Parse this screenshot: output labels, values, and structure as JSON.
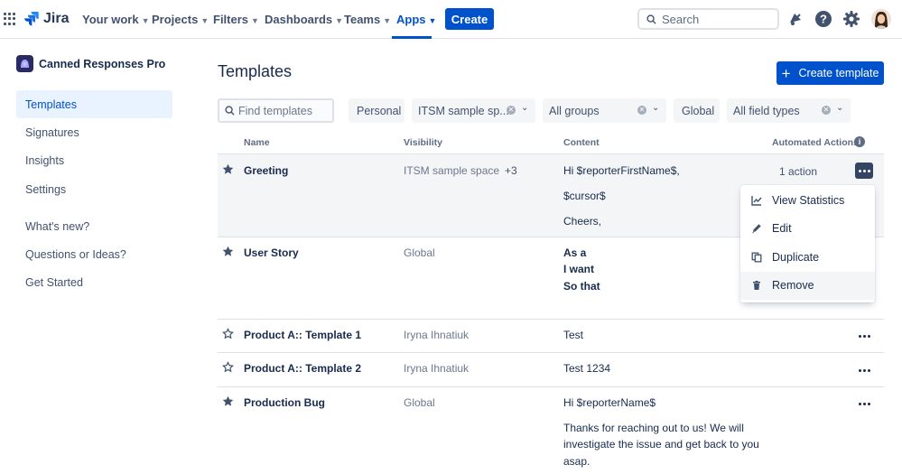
{
  "nav": {
    "logo_text": "Jira",
    "items": [
      {
        "label": "Your work"
      },
      {
        "label": "Projects"
      },
      {
        "label": "Filters"
      },
      {
        "label": "Dashboards"
      },
      {
        "label": "Teams"
      },
      {
        "label": "Apps"
      }
    ],
    "active_item": "Apps",
    "create_label": "Create",
    "search_placeholder": "Search",
    "icons": [
      "apps-grid-icon",
      "jira-logo-icon",
      "notifications-icon",
      "help-icon",
      "settings-icon",
      "profile-avatar"
    ]
  },
  "sidebar": {
    "app_name": "Canned Responses Pro",
    "items": [
      {
        "label": "Templates"
      },
      {
        "label": "Signatures"
      },
      {
        "label": "Insights"
      },
      {
        "label": "Settings"
      },
      {
        "label": "What's new?"
      },
      {
        "label": "Questions or Ideas?"
      },
      {
        "label": "Get Started"
      }
    ],
    "active_item": "Templates"
  },
  "main": {
    "title": "Templates",
    "create_button": "Create template",
    "filters": {
      "search_placeholder": "Find templates",
      "personal": "Personal",
      "space": "ITSM sample sp...",
      "groups": "All groups",
      "global": "Global",
      "field_types": "All field types"
    },
    "columns": {
      "name": "Name",
      "visibility": "Visibility",
      "content": "Content",
      "automated_actions": "Automated Actions"
    },
    "rows": [
      {
        "name": "Greeting",
        "starred": true,
        "visibility": "ITSM sample space",
        "visibility_more": "+3",
        "content": [
          "Hi $reporterFirstName$,",
          "$cursor$",
          "Cheers,"
        ],
        "actions": "1 action"
      },
      {
        "name": "User Story",
        "starred": true,
        "visibility": "Global",
        "content": [
          "As a",
          "I want",
          "So that"
        ]
      },
      {
        "name": "Product A:: Template 1",
        "starred": false,
        "visibility": "Iryna Ihnatiuk",
        "content": [
          "Test"
        ]
      },
      {
        "name": "Product A:: Template 2",
        "starred": false,
        "visibility": "Iryna Ihnatiuk",
        "content": [
          "Test 1234"
        ]
      },
      {
        "name": "Production Bug",
        "starred": true,
        "visibility": "Global",
        "content": [
          "Hi $reporterName$",
          "Thanks for reaching out to us! We will",
          "investigate the issue and get back to you",
          "asap."
        ]
      }
    ],
    "menu": {
      "items": [
        {
          "label": "View Statistics",
          "icon": "chart-icon"
        },
        {
          "label": "Edit",
          "icon": "pencil-icon"
        },
        {
          "label": "Duplicate",
          "icon": "copy-icon"
        },
        {
          "label": "Remove",
          "icon": "trash-icon"
        }
      ],
      "hovered": "Remove"
    }
  },
  "colors": {
    "brand": "#0052cc",
    "text": "#172b4d",
    "muted": "#6b778c",
    "highlight_row": "#f4f5f7",
    "active_sidebar": "#e9f2ff"
  }
}
